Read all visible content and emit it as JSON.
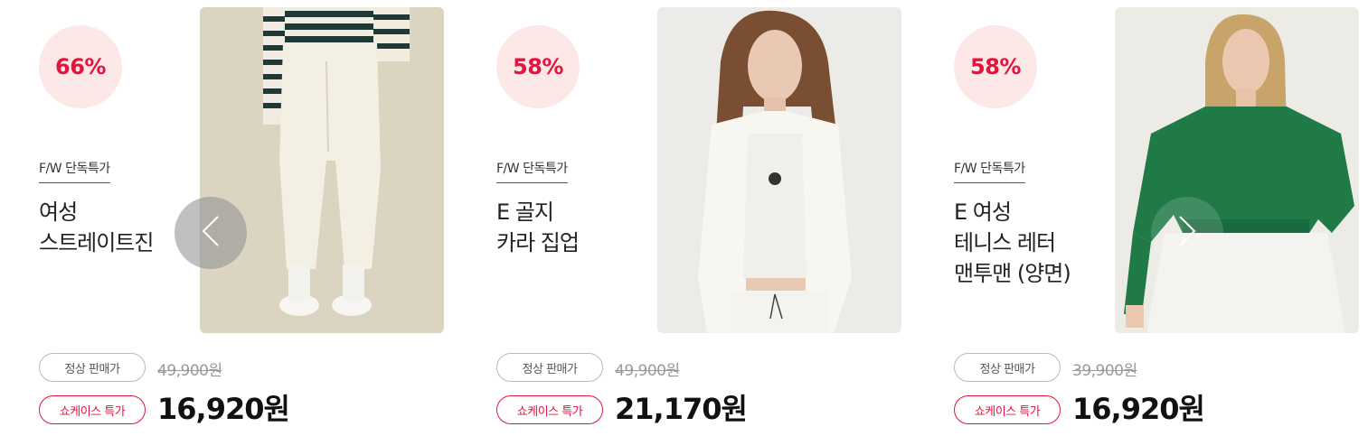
{
  "nav": {
    "prev_icon": "chevron-left-icon",
    "next_icon": "chevron-right-icon"
  },
  "products": [
    {
      "discount": "66%",
      "tag": "F/W 단독특가",
      "name_lines": [
        "여성",
        "스트레이트진"
      ],
      "regular_label": "정상 판매가",
      "regular_price": "49,900원",
      "special_label": "쇼케이스 특가",
      "special_price": "16,920원"
    },
    {
      "discount": "58%",
      "tag": "F/W 단독특가",
      "name_lines": [
        "E 골지",
        "카라 집업"
      ],
      "regular_label": "정상 판매가",
      "regular_price": "49,900원",
      "special_label": "쇼케이스 특가",
      "special_price": "21,170원"
    },
    {
      "discount": "58%",
      "tag": "F/W 단독특가",
      "name_lines": [
        "E 여성",
        "테니스 레터",
        "맨투맨 (양면)"
      ],
      "regular_label": "정상 판매가",
      "regular_price": "39,900원",
      "special_label": "쇼케이스 특가",
      "special_price": "16,920원"
    }
  ],
  "colors": {
    "accent": "#e4143c",
    "badge_bg": "#fde8e8"
  }
}
